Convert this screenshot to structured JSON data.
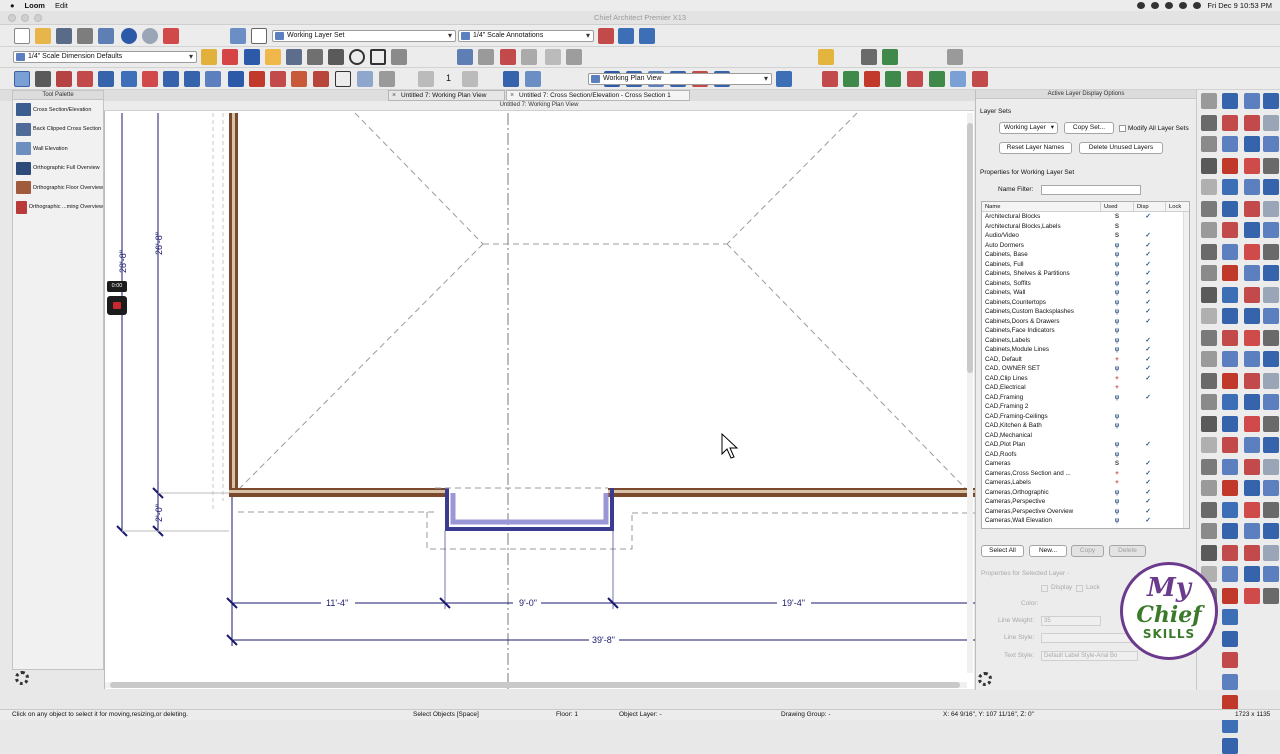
{
  "menubar": {
    "apple": "",
    "app": "Loom",
    "edit": "Edit",
    "clock": "Fri Dec 9  10:53 PM"
  },
  "window": {
    "title": "Chief Architect Premier X13"
  },
  "toolbar": {
    "layer_set": "Working Layer Set",
    "annotation_set": "1/4\" Scale Annotations",
    "dimension_defaults": "1/4\" Scale Dimension Defaults",
    "plan_view": "Working Plan View",
    "counter": "1"
  },
  "tabs": [
    {
      "label": "Untitled 7:  Working Plan View"
    },
    {
      "label": "Untitled 7: Cross Section/Elevation - Cross Section 1"
    }
  ],
  "palette": {
    "title": "Tool Palette",
    "items": [
      {
        "label": "Cross Section/Elevation",
        "color": "#3c5d8f"
      },
      {
        "label": "Back Clipped Cross Section",
        "color": "#4f6c99"
      },
      {
        "label": "Wall Elevation",
        "color": "#6c8fbf"
      },
      {
        "label": "Orthographic Full Overview",
        "color": "#2d4b78"
      },
      {
        "label": "Orthographic Floor Overview",
        "color": "#a05a3c"
      },
      {
        "label": "Orthographic ...ming Overview",
        "color": "#b83a3a"
      }
    ]
  },
  "canvas": {
    "header": "Untitled 7:  Working Plan View",
    "dims": {
      "top_left_v1": "28'-8\"",
      "top_left_v2": "26'-8\"",
      "bottom_v": "2'-0\"",
      "seg1": "11'-4\"",
      "seg2": "9'-0\"",
      "seg3": "19'-4\"",
      "overall": "39'-8\""
    },
    "loom_timer": "0:00"
  },
  "layers_panel": {
    "title": "Active Layer Display Options",
    "layer_sets_label": "Layer Sets",
    "layer_set_value": "Working Layer",
    "copy_set": "Copy Set...",
    "modify_all": "Modify All Layer Sets",
    "reset_names": "Reset Layer Names",
    "delete_unused": "Delete Unused Layers",
    "properties_for": "Properties for  Working Layer Set",
    "name_filter": "Name Filter:",
    "columns": [
      "Name",
      "Used",
      "Disp",
      "Lock"
    ],
    "rows": [
      {
        "name": "Architectural Blocks",
        "used": "S",
        "disp": "✓"
      },
      {
        "name": "Architectural Blocks,Labels",
        "used": "S",
        "disp": ""
      },
      {
        "name": "Audio/Video",
        "used": "S",
        "disp": "✓"
      },
      {
        "name": "Auto Dormers",
        "used": "ψ",
        "disp": "✓"
      },
      {
        "name": "Cabinets, Base",
        "used": "ψ",
        "disp": "✓"
      },
      {
        "name": "Cabinets, Full",
        "used": "ψ",
        "disp": "✓"
      },
      {
        "name": "Cabinets, Shelves & Partitions",
        "used": "ψ",
        "disp": "✓"
      },
      {
        "name": "Cabinets, Soffits",
        "used": "ψ",
        "disp": "✓"
      },
      {
        "name": "Cabinets, Wall",
        "used": "ψ",
        "disp": "✓"
      },
      {
        "name": "Cabinets,Countertops",
        "used": "ψ",
        "disp": "✓"
      },
      {
        "name": "Cabinets,Custom Backsplashes",
        "used": "ψ",
        "disp": "✓"
      },
      {
        "name": "Cabinets,Doors & Drawers",
        "used": "ψ",
        "disp": "✓"
      },
      {
        "name": "Cabinets,Face Indicators",
        "used": "ψ",
        "disp": ""
      },
      {
        "name": "Cabinets,Labels",
        "used": "ψ",
        "disp": "✓"
      },
      {
        "name": "Cabinets,Module Lines",
        "used": "ψ",
        "disp": "✓"
      },
      {
        "name": "CAD, Default",
        "used": "+",
        "disp": "✓"
      },
      {
        "name": "CAD, OWNER SET",
        "used": "ψ",
        "disp": "✓"
      },
      {
        "name": "CAD,Clip Lines",
        "used": "+",
        "disp": "✓"
      },
      {
        "name": "CAD,Electrical",
        "used": "+",
        "disp": ""
      },
      {
        "name": "CAD,Framing",
        "used": "ψ",
        "disp": "✓"
      },
      {
        "name": "CAD,Framing 2",
        "used": "",
        "disp": ""
      },
      {
        "name": "CAD,Framing-Ceilings",
        "used": "ψ",
        "disp": ""
      },
      {
        "name": "CAD,Kitchen & Bath",
        "used": "ψ",
        "disp": ""
      },
      {
        "name": "CAD,Mechanical",
        "used": "",
        "disp": ""
      },
      {
        "name": "CAD,Plot Plan",
        "used": "ψ",
        "disp": "✓"
      },
      {
        "name": "CAD,Roofs",
        "used": "ψ",
        "disp": ""
      },
      {
        "name": "Cameras",
        "used": "S",
        "disp": "✓"
      },
      {
        "name": "Cameras,Cross Section and ...",
        "used": "+",
        "disp": "✓"
      },
      {
        "name": "Cameras,Labels",
        "used": "+",
        "disp": "✓"
      },
      {
        "name": "Cameras,Orthographic",
        "used": "ψ",
        "disp": "✓"
      },
      {
        "name": "Cameras,Perspective",
        "used": "ψ",
        "disp": "✓"
      },
      {
        "name": "Cameras,Perspective Overview",
        "used": "ψ",
        "disp": "✓"
      },
      {
        "name": "Cameras,Wall Elevation",
        "used": "ψ",
        "disp": "✓"
      }
    ],
    "select_all": "Select All",
    "new": "New...",
    "copy": "Copy",
    "delete": "Delete",
    "selected_props": "Properties for Selected Layer -",
    "display": "Display",
    "lock": "Lock",
    "color": "Color:",
    "line_weight": "Line Weight:",
    "line_weight_val": "35",
    "line_style": "Line Style:",
    "text_style": "Text Style:",
    "text_style_val": "Default Label Style-Arial Bo"
  },
  "logo": {
    "line1": "My",
    "line2": "Chief",
    "line3": "SKILLS"
  },
  "status": {
    "hint": "Click on any object to select it for moving,resizing,or deleting.",
    "mode": "Select Objects [Space]",
    "floor": "Floor: 1",
    "object_layer": "Object Layer: -",
    "drawing_group": "Drawing Group: -",
    "coords": "X: 64 9/16\", Y: 107 11/16\", Z: 0\"",
    "size": "1723 x 1135"
  }
}
